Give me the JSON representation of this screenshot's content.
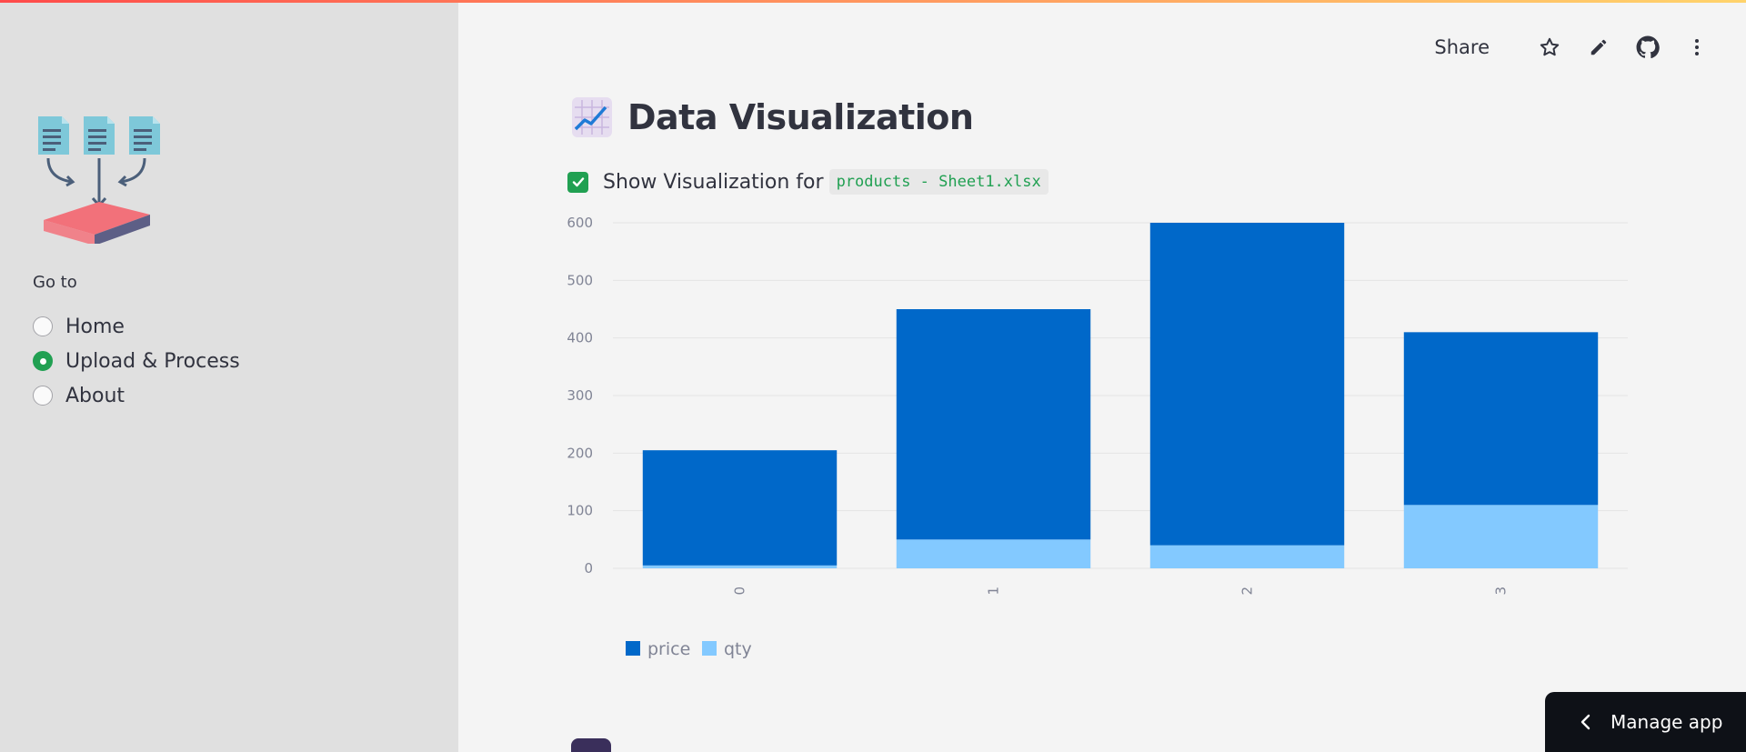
{
  "sidebar": {
    "logo_icon": "documents-merge-icon",
    "nav_heading": "Go to",
    "options": [
      {
        "label": "Home",
        "selected": false
      },
      {
        "label": "Upload & Process",
        "selected": true
      },
      {
        "label": "About",
        "selected": false
      }
    ]
  },
  "toolbar": {
    "share_label": "Share",
    "icons": [
      "star-icon",
      "pencil-icon",
      "github-icon",
      "more-vertical-icon"
    ]
  },
  "main": {
    "title": "Data Visualization",
    "title_icon": "chart-increasing-icon",
    "checkbox": {
      "checked": true,
      "label": "Show Visualization for",
      "file_name": "products - Sheet1.xlsx"
    }
  },
  "chart_data": {
    "type": "bar",
    "stacked": true,
    "categories": [
      "0",
      "1",
      "2",
      "3"
    ],
    "series": [
      {
        "name": "price",
        "values": [
          200,
          400,
          560,
          300
        ],
        "color": "#0068c9"
      },
      {
        "name": "qty",
        "values": [
          5,
          50,
          40,
          110
        ],
        "color": "#83c9ff"
      }
    ],
    "y_ticks": [
      "0",
      "100",
      "200",
      "300",
      "400",
      "500",
      "600"
    ],
    "ylim": [
      0,
      600
    ],
    "grid": true,
    "legend_position": "bottom-left"
  },
  "manage_app": {
    "label": "Manage app"
  }
}
